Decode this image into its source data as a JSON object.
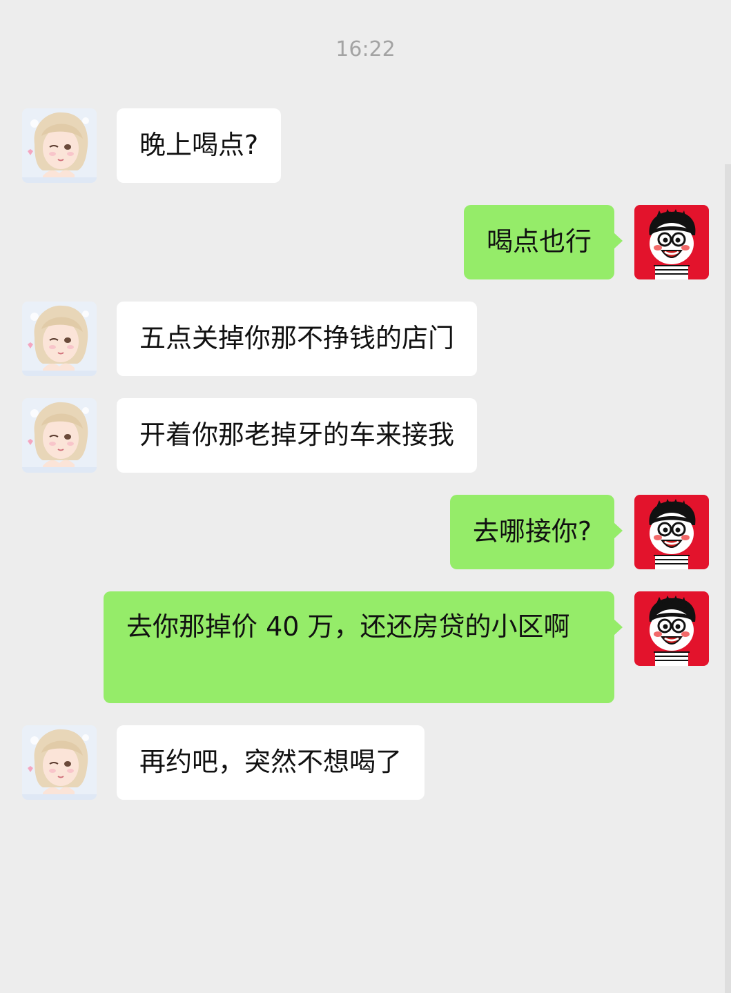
{
  "chat": {
    "timestamp": "16:22",
    "messages": [
      {
        "sender": "friend",
        "text": "晚上喝点?"
      },
      {
        "sender": "me",
        "text": "喝点也行"
      },
      {
        "sender": "friend",
        "text": "五点关掉你那不挣钱的店门"
      },
      {
        "sender": "friend",
        "text": "开着你那老掉牙的车来接我"
      },
      {
        "sender": "me",
        "text": "去哪接你?"
      },
      {
        "sender": "me",
        "text": "去你那掉价 40 万，还还房贷的小区啊"
      },
      {
        "sender": "friend",
        "text": "再约吧，突然不想喝了"
      }
    ]
  },
  "colors": {
    "background": "#ededed",
    "incoming_bubble": "#ffffff",
    "outgoing_bubble": "#95ec69",
    "timestamp_text": "#a3a3a3",
    "my_avatar_bg": "#e3132c"
  },
  "icons": {
    "friend_avatar": "anime-girl-avatar-icon",
    "my_avatar": "cartoon-boy-avatar-icon"
  }
}
